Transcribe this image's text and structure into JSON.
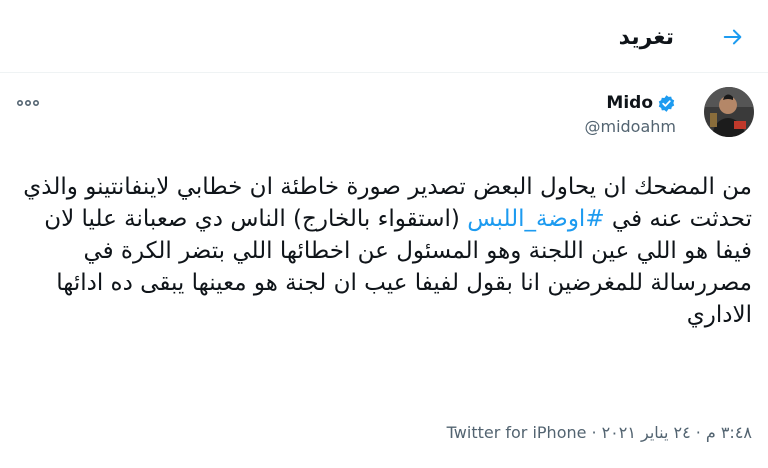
{
  "header": {
    "title": "تغريد",
    "back_icon": "arrow-right-icon"
  },
  "tweet": {
    "author": {
      "name": "Mido",
      "handle": "@midoahm",
      "verified": true,
      "avatar_icon": "user-avatar"
    },
    "text": {
      "before_hashtag": "من المضحك ان يحاول البعض تصدير صورة خاطئة ان خطابي لاينفانتينو والذي تحدثت عنه في ",
      "hashtag": "#اوضة_اللبس",
      "after_hashtag": " (استقواء بالخارج) الناس دي صعبانة عليا لان فيفا هو اللي عين اللجنة وهو المسئول عن اخطائها اللي بتضر الكرة في مصررسالة للمغرضين انا بقول لفيفا عيب ان لجنة هو معينها يبقى ده ادائها الاداري"
    },
    "meta": {
      "time": "٣:٤٨ م",
      "date": "٢٤ يناير ٢٠٢١",
      "separator": "·",
      "source": "Twitter for iPhone"
    },
    "more_icon": "more-horizontal-icon"
  },
  "colors": {
    "accent": "#1d9bf0",
    "text_primary": "#0f1419",
    "text_secondary": "#536471",
    "divider": "#eff3f4"
  }
}
